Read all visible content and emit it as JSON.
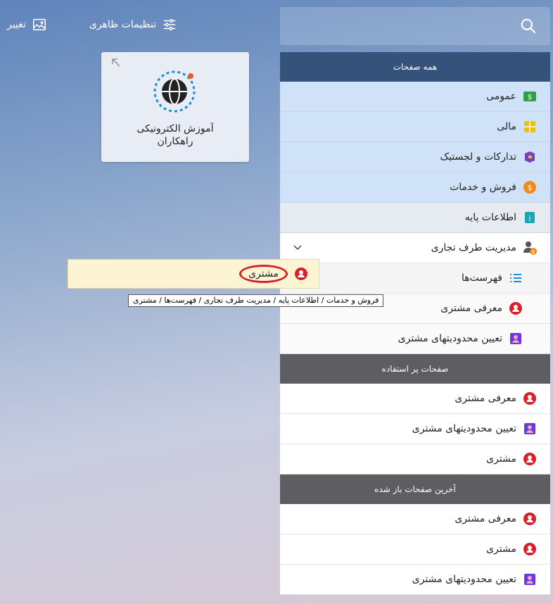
{
  "topbar": {
    "change_label": "تغییر",
    "appearance_label": "تنظیمات ظاهری"
  },
  "tile": {
    "title_line1": "آموزش الکترونیکی",
    "title_line2": "راهکاران"
  },
  "panel": {
    "all_pages": "همه صفحات",
    "categories": [
      {
        "label": "عمومی",
        "icon": "dollar-box-icon",
        "color": "#2e9e47"
      },
      {
        "label": "مالی",
        "icon": "calculator-icon",
        "color": "#e8b400"
      },
      {
        "label": "تدارکات و لجستیک",
        "icon": "box-icon",
        "color": "#7a3fc1"
      },
      {
        "label": "فروش و خدمات",
        "icon": "coin-icon",
        "color": "#f28a1e"
      },
      {
        "label": "اطلاعات پایه",
        "icon": "info-icon",
        "color": "#1aa6b5"
      },
      {
        "label": "مدیریت طرف تجاری",
        "icon": "person-coin-icon",
        "color": "#555"
      }
    ],
    "sub": [
      {
        "label": "فهرست‌ها",
        "icon": "list-icon"
      },
      {
        "label": "معرفی مشتری",
        "icon": "customer-icon"
      },
      {
        "label": "تعیین محدودیتهای مشتری",
        "icon": "customer-limit-icon"
      }
    ],
    "frequent_header": "صفحات پر استفاده",
    "frequent": [
      {
        "label": "معرفی مشتری"
      },
      {
        "label": "تعیین محدودیتهای مشتری"
      },
      {
        "label": "مشتری"
      }
    ],
    "recent_header": "آخرین صفحات باز شده",
    "recent": [
      {
        "label": "معرفی مشتری"
      },
      {
        "label": "مشتری"
      },
      {
        "label": "تعیین محدودیتهای مشتری"
      }
    ]
  },
  "popup": {
    "label": "مشتری"
  },
  "tooltip": {
    "path": "فروش و خدمات / اطلاعات پایه / مدیریت طرف تجاری / فهرست‌ها / مشتری"
  }
}
